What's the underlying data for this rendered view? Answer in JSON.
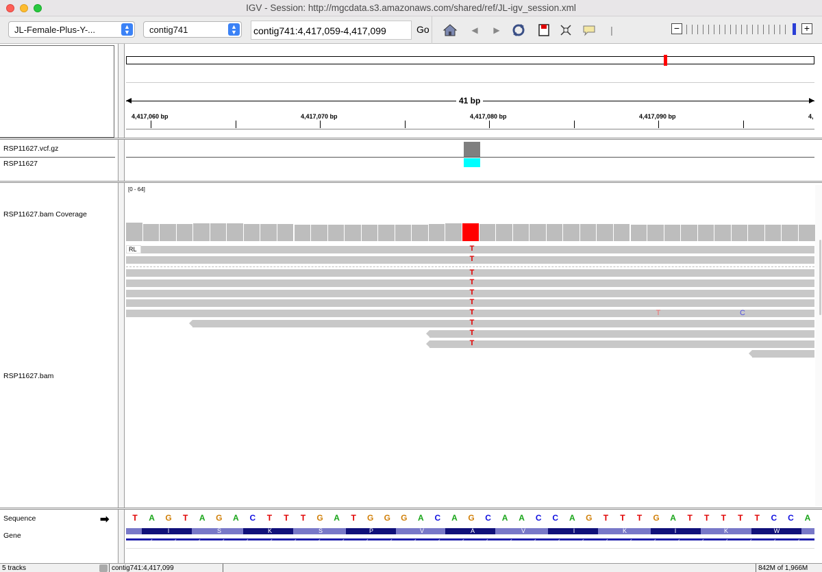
{
  "window": {
    "title": "IGV - Session: http://mgcdata.s3.amazonaws.com/shared/ref/JL-igv_session.xml"
  },
  "toolbar": {
    "genome": "JL-Female-Plus-Y-...",
    "chromosome": "contig741",
    "locus": "contig741:4,417,059-4,417,099",
    "go_label": "Go",
    "icons": [
      "home-icon",
      "back-icon",
      "forward-icon",
      "refresh-icon",
      "roi-icon",
      "fit-icon",
      "popup-icon",
      "ruler-icon"
    ]
  },
  "ruler": {
    "span": "41 bp",
    "ticks": [
      "4,417,060 bp",
      "4,417,070 bp",
      "4,417,080 bp",
      "4,417,090 bp",
      "4,"
    ]
  },
  "tracks": {
    "vcf": "RSP11627.vcf.gz",
    "sample": "RSP11627",
    "coverage": "RSP11627.bam Coverage",
    "coverage_range": "[0 - 64]",
    "bam": "RSP11627.bam",
    "bam_group": "RL",
    "sequence": "Sequence",
    "gene": "Gene"
  },
  "variant": {
    "ref": "G",
    "alt": "T"
  },
  "mismatches": [
    {
      "base": "T",
      "color": "#e00000"
    },
    {
      "base": "T",
      "color": "#e00000"
    },
    {
      "base": "T",
      "color": "#e00000"
    },
    {
      "base": "T",
      "color": "#e00000"
    },
    {
      "base": "T",
      "color": "#e00000"
    },
    {
      "base": "T",
      "color": "#e00000"
    },
    {
      "base": "T",
      "color": "#e00000"
    },
    {
      "base": "T",
      "color": "#e00000"
    },
    {
      "base": "T",
      "color": "#e00000"
    },
    {
      "base": "T",
      "color": "#e00000"
    }
  ],
  "other_mismatches": [
    {
      "base": "T",
      "color": "#f07070"
    },
    {
      "base": "C",
      "color": "#5050e0"
    }
  ],
  "sequence": "TAGTAGACTTTGATGGGACAGCAACCAGTTTGATTTTTCCAT",
  "base_colors": {
    "A": "#1aa51a",
    "C": "#1010e0",
    "G": "#d1800a",
    "T": "#e00000"
  },
  "amino_acids": [
    "I",
    "S",
    "K",
    "S",
    "P",
    "V",
    "A",
    "V",
    "I",
    "K",
    "I",
    "K",
    "W"
  ],
  "status": {
    "tracks": "5 tracks",
    "position": "contig741:4,417,099",
    "memory": "842M of 1,966M"
  }
}
